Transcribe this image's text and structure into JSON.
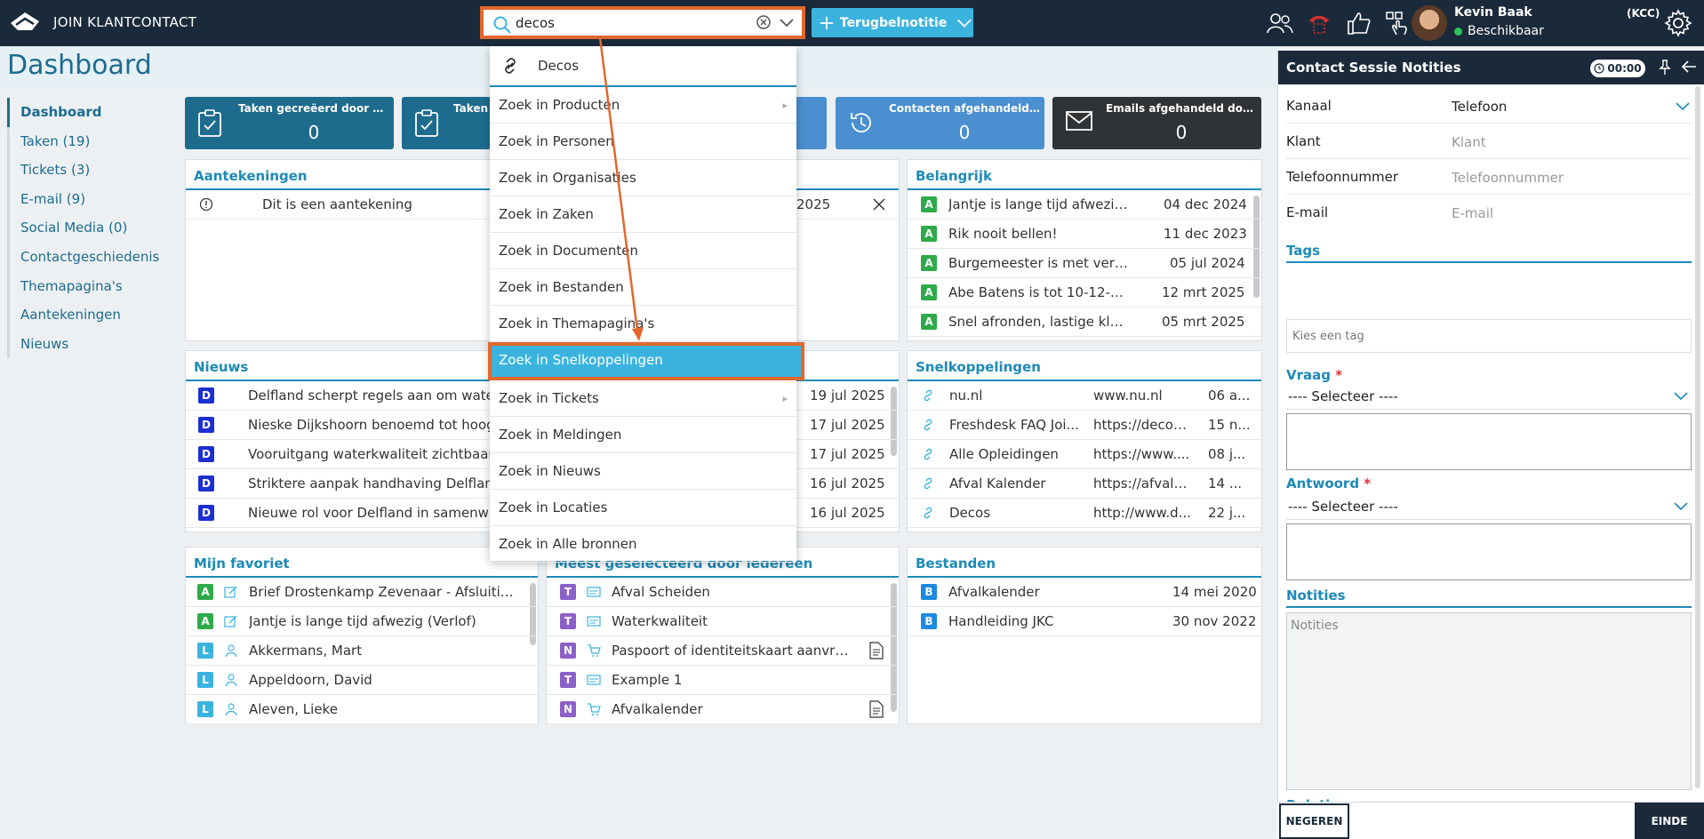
{
  "topbar": {
    "app_name": "JOIN KLANTCONTACT",
    "search_value": "decos",
    "terug_label": "Terugbelnotitie",
    "user_name": "Kevin Baak",
    "user_status": "Beschikbaar",
    "kcc": "(KCC)",
    "icons": [
      "contacts-icon",
      "phone-icon",
      "thumbs-up-icon",
      "touch-icon",
      "gear-icon"
    ],
    "accent": "#3bb3df",
    "highlight": "#e2672d"
  },
  "dashboard": {
    "title": "Dashboard"
  },
  "leftnav": {
    "items": [
      {
        "label": "Dashboard"
      },
      {
        "label": "Taken (19)"
      },
      {
        "label": "Tickets (3)"
      },
      {
        "label": "E-mail (9)"
      },
      {
        "label": "Social Media (0)"
      },
      {
        "label": "Contactgeschiedenis"
      },
      {
        "label": "Themapagina's"
      },
      {
        "label": "Aantekeningen"
      },
      {
        "label": "Nieuws"
      }
    ]
  },
  "tiles": [
    {
      "label": "Taken gecreëerd door mij",
      "value": "0",
      "color": "#1d6c8e"
    },
    {
      "label": "Taken",
      "value": "",
      "color": "#1d6c8e"
    },
    {
      "label": "",
      "value": "",
      "color": "#4a8fd0"
    },
    {
      "label": "Contacten afgehandeld ...",
      "value": "0",
      "color": "#4a8fd0"
    },
    {
      "label": "Emails afgehandeld doo...",
      "value": "0",
      "color": "#2f3336"
    }
  ],
  "aantekeningen": {
    "title": "Aantekeningen",
    "rows": [
      {
        "text": "Dit is een aantekening",
        "date": "2025"
      }
    ]
  },
  "belangrijk": {
    "title": "Belangrijk",
    "rows": [
      {
        "badge": "A",
        "text": "Jantje is lange tijd afwezig (Verl...",
        "date": "04 dec 2024"
      },
      {
        "badge": "A",
        "text": "Rik nooit bellen!",
        "date": "11 dec 2023"
      },
      {
        "badge": "A",
        "text": "Burgemeester is met verlof",
        "date": "05 jul 2024"
      },
      {
        "badge": "A",
        "text": "Abe Batens is tot 10-12-2024 m...",
        "date": "12 mrt 2025"
      },
      {
        "badge": "A",
        "text": "Snel afronden, lastige klant",
        "date": "05 mrt 2025"
      }
    ]
  },
  "nieuws": {
    "title": "Nieuws",
    "rows": [
      {
        "badge": "D",
        "text": "Delfland scherpt regels aan om water",
        "date": "19 jul 2025"
      },
      {
        "badge": "D",
        "text": "Nieske Dijkshoorn benoemd tot hoog",
        "date": "17 jul 2025"
      },
      {
        "badge": "D",
        "text": "Vooruitgang waterkwaliteit zichtbaar,",
        "date": "17 jul 2025"
      },
      {
        "badge": "D",
        "text": "Striktere aanpak handhaving Delfland",
        "date": "16 jul 2025"
      },
      {
        "badge": "D",
        "text": "Nieuwe rol voor Delfland in samenwe",
        "date": "16 jul 2025"
      }
    ]
  },
  "snelkoppelingen": {
    "title": "Snelkoppelingen",
    "rows": [
      {
        "text": "nu.nl",
        "url": "www.nu.nl",
        "date": "06 a..."
      },
      {
        "text": "Freshdesk FAQ Joi...",
        "url": "https://decos....",
        "date": "15 n..."
      },
      {
        "text": "Alle Opleidingen",
        "url": "https://www....",
        "date": "08 j..."
      },
      {
        "text": "Afval Kalender",
        "url": "https://afvalk...",
        "date": "14 ..."
      },
      {
        "text": "Decos",
        "url": "http://www.d...",
        "date": "22 j..."
      }
    ]
  },
  "favoriet": {
    "title": "Mijn favoriet",
    "rows": [
      {
        "badge": "A",
        "icon": "edit-icon",
        "text": "Brief Drostenkamp Zevenaar - Afsluiting..."
      },
      {
        "badge": "A",
        "icon": "edit-icon",
        "text": "Jantje is lange tijd afwezig (Verlof)"
      },
      {
        "badge": "L",
        "icon": "person-icon",
        "text": "Akkermans, Mart"
      },
      {
        "badge": "L",
        "icon": "person-icon",
        "text": "Appeldoorn, David"
      },
      {
        "badge": "L",
        "icon": "person-icon",
        "text": "Aleven, Lieke"
      }
    ]
  },
  "meest": {
    "title": "Meest geselecteerd door iedereen",
    "rows": [
      {
        "badge": "T",
        "icon": "card-icon",
        "text": "Afval Scheiden",
        "doc": false
      },
      {
        "badge": "T",
        "icon": "card-icon",
        "text": "Waterkwaliteit",
        "doc": false
      },
      {
        "badge": "N",
        "icon": "cart-icon",
        "text": "Paspoort of identiteitskaart aanvrag...",
        "doc": true
      },
      {
        "badge": "T",
        "icon": "card-icon",
        "text": "Example 1",
        "doc": false
      },
      {
        "badge": "N",
        "icon": "cart-icon",
        "text": "Afvalkalender",
        "doc": true
      }
    ]
  },
  "bestanden": {
    "title": "Bestanden",
    "rows": [
      {
        "badge": "B",
        "text": "Afvalkalender",
        "date": "14 mei 2020"
      },
      {
        "badge": "B",
        "text": "Handleiding JKC",
        "date": "30 nov 2022"
      }
    ]
  },
  "dropdown": {
    "first": "Decos",
    "items": [
      {
        "label": "Zoek in Producten",
        "sub": true
      },
      {
        "label": "Zoek in Personen",
        "sub": false
      },
      {
        "label": "Zoek in Organisaties",
        "sub": false
      },
      {
        "label": "Zoek in Zaken",
        "sub": false
      },
      {
        "label": "Zoek in Documenten",
        "sub": false
      },
      {
        "label": "Zoek in Bestanden",
        "sub": false
      },
      {
        "label": "Zoek in Themapagina's",
        "sub": false
      },
      {
        "label": "Zoek in Snelkoppelingen",
        "sub": false,
        "selected": true
      },
      {
        "label": "Zoek in Tickets",
        "sub": true
      },
      {
        "label": "Zoek in Meldingen",
        "sub": false
      },
      {
        "label": "Zoek in Nieuws",
        "sub": false
      },
      {
        "label": "Zoek in Locaties",
        "sub": false
      },
      {
        "label": "Zoek in Alle bronnen",
        "sub": false
      }
    ]
  },
  "session": {
    "title": "Contact Sessie Notities",
    "timer": "00:00",
    "kanaal_label": "Kanaal",
    "kanaal_value": "Telefoon",
    "klant_label": "Klant",
    "klant_placeholder": "Klant",
    "tel_label": "Telefoonnummer",
    "tel_placeholder": "Telefoonnummer",
    "email_label": "E-mail",
    "email_placeholder": "E-mail",
    "tags_label": "Tags",
    "tags_placeholder": "Kies een tag",
    "vraag_label": "Vraag",
    "vraag_select": "---- Selecteer ----",
    "antwoord_label": "Antwoord",
    "antwoord_select": "---- Selecteer ----",
    "notities_label": "Notities",
    "notities_placeholder": "Notities",
    "relaties_label": "Relaties",
    "negeren": "NEGEREN",
    "einde": "EINDE"
  }
}
